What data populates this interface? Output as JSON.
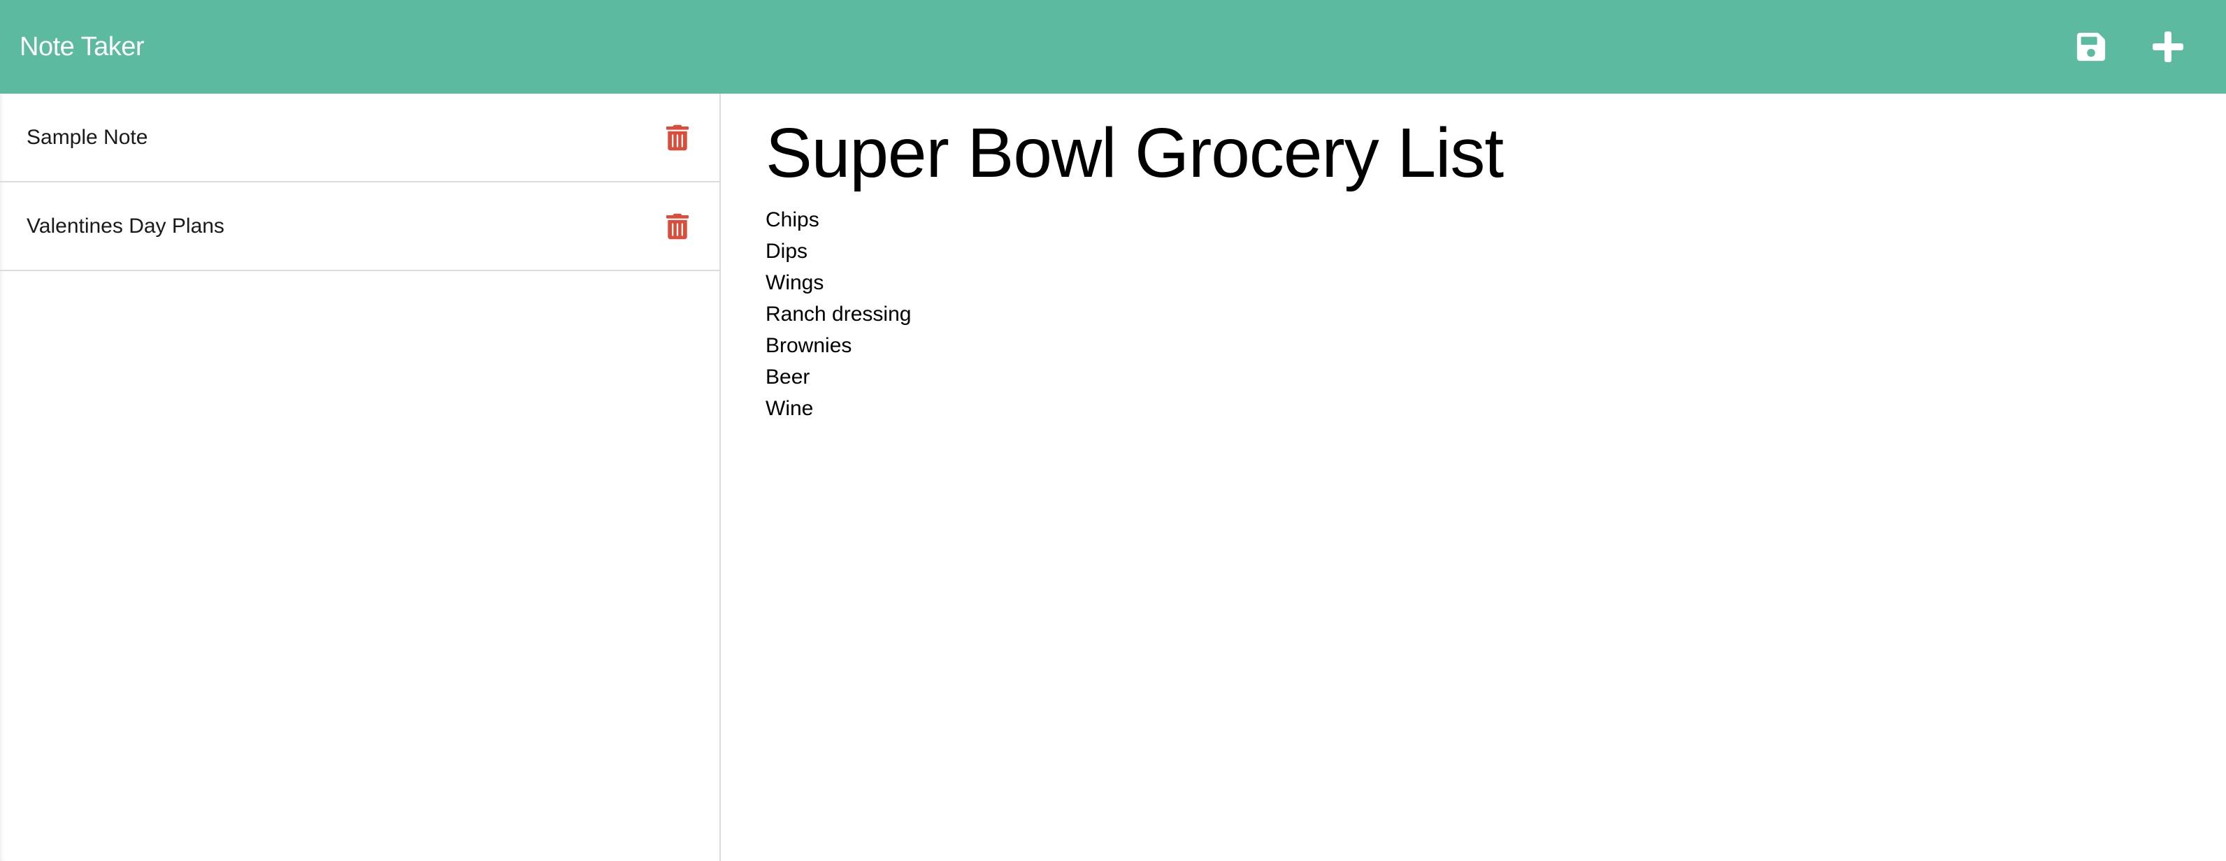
{
  "app": {
    "brand": "Note Taker",
    "accent_color": "#5bba9f",
    "delete_color": "#dc4c3a"
  },
  "navbar": {
    "actions": [
      {
        "icon": "save-icon"
      },
      {
        "icon": "plus-icon"
      }
    ]
  },
  "sidebar": {
    "notes": [
      {
        "title": "Sample Note",
        "icon": "trash-icon"
      },
      {
        "title": "Valentines Day Plans",
        "icon": "trash-icon"
      }
    ]
  },
  "active_note": {
    "title": "Super Bowl Grocery List",
    "lines": [
      "Chips",
      "Dips",
      "Wings",
      "Ranch dressing",
      "Brownies",
      "Beer",
      "Wine"
    ]
  }
}
